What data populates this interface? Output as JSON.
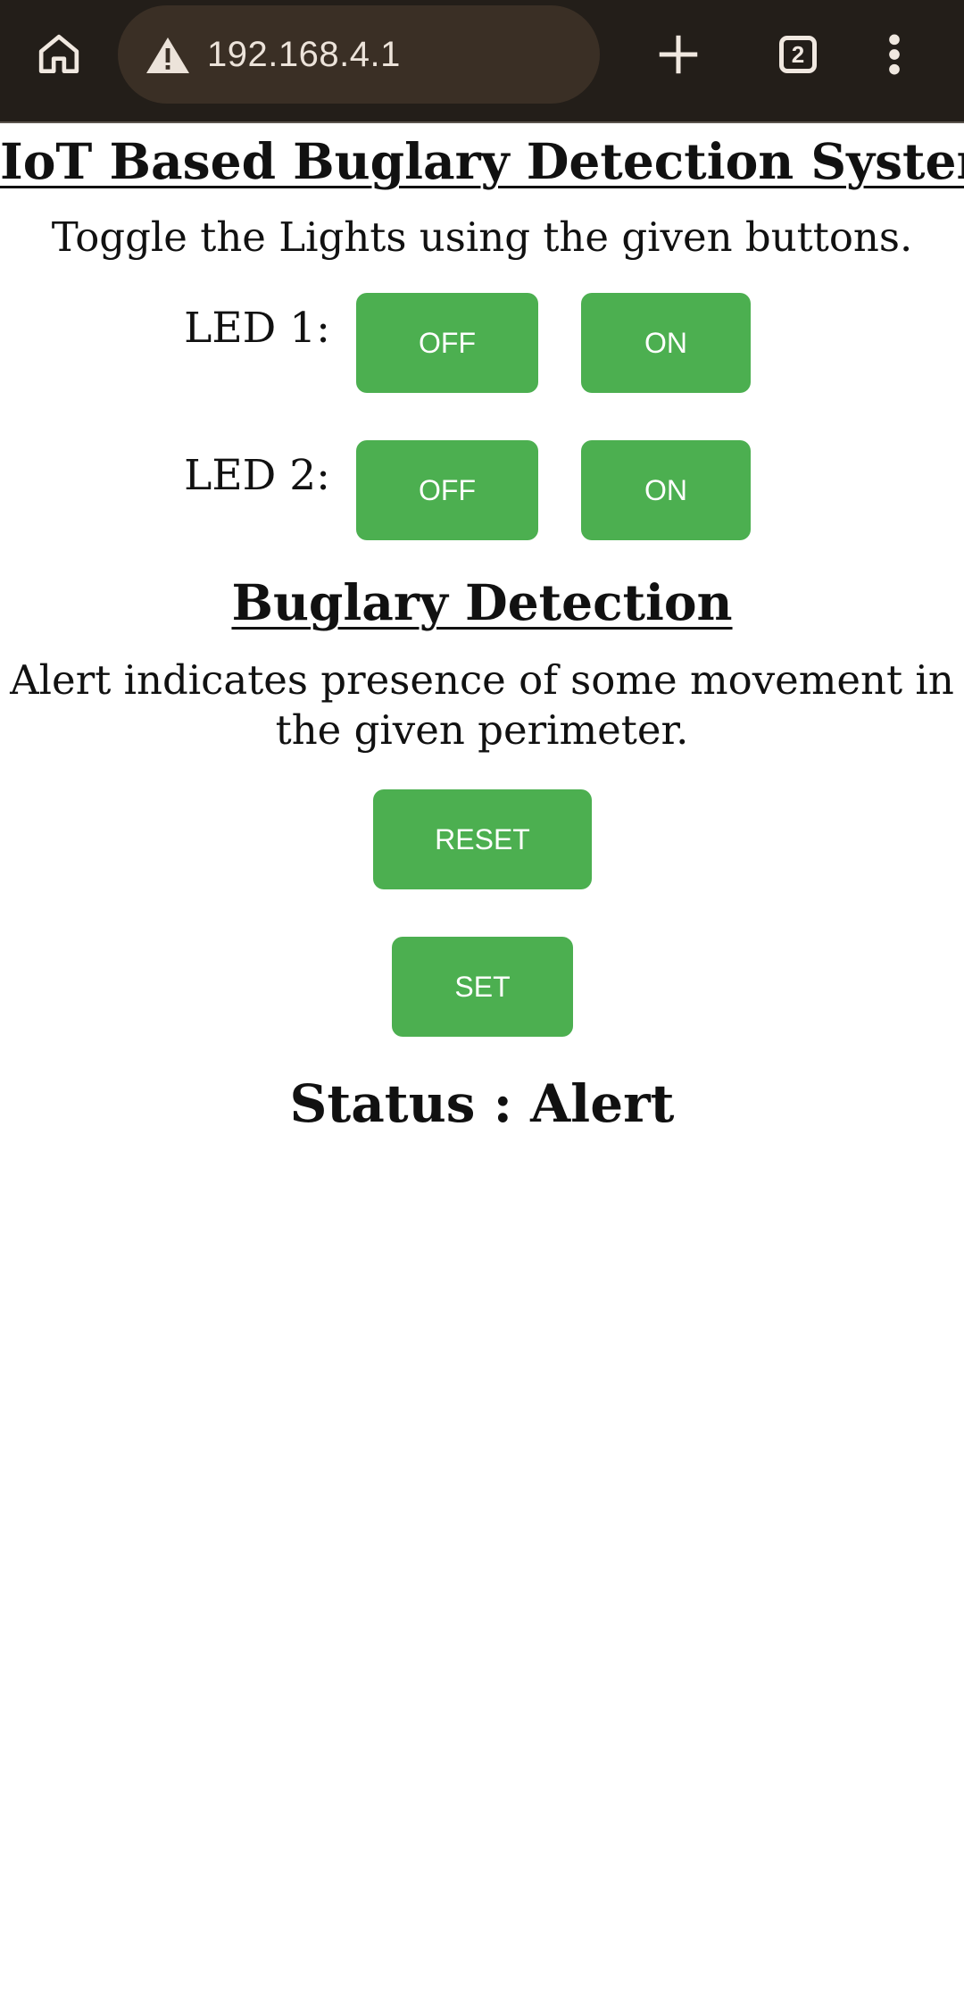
{
  "browser": {
    "url": "192.168.4.1",
    "tab_count": "2",
    "icons": {
      "home": "home-icon",
      "warning": "warning-icon",
      "new_tab": "plus-icon",
      "tabs": "tab-switcher-icon",
      "menu": "more-vert-icon"
    }
  },
  "page": {
    "title": "IoT Based Buglary Detection System",
    "subtitle": "Toggle the Lights using the given buttons.",
    "leds": [
      {
        "label": "LED 1:",
        "off_label": "OFF",
        "on_label": "ON"
      },
      {
        "label": "LED 2:",
        "off_label": "OFF",
        "on_label": "ON"
      }
    ],
    "section_title": "Buglary Detection",
    "description": "Alert indicates presence of some movement in the given perimeter.",
    "reset_label": "RESET",
    "set_label": "SET",
    "status": "Status : Alert"
  },
  "colors": {
    "toolbar_bg": "#231e19",
    "url_bar_bg": "#3a2f25",
    "button_green": "#4caf50",
    "button_text": "#ffffff"
  }
}
